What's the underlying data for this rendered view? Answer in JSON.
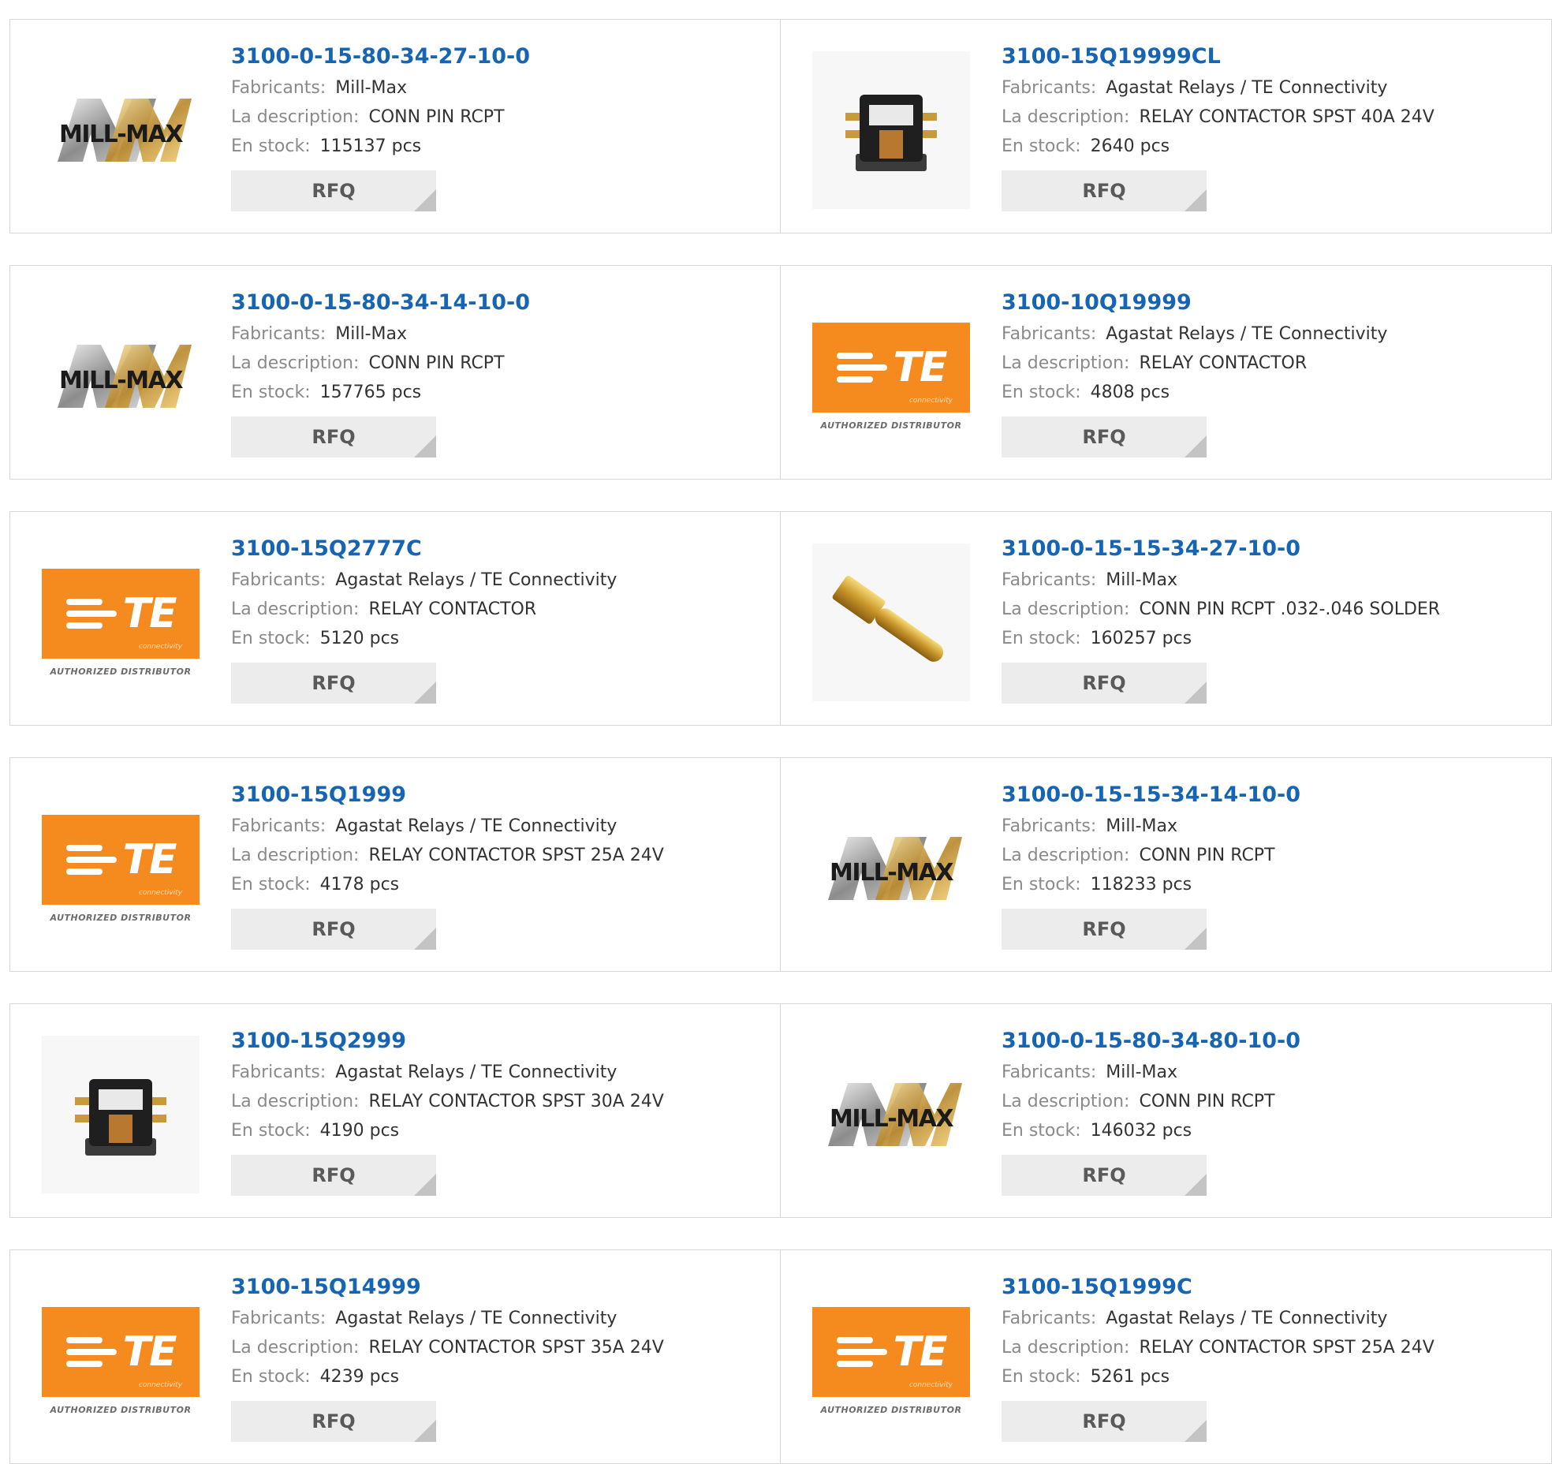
{
  "labels": {
    "manufacturer": "Fabricants:",
    "description": "La description:",
    "stock": "En stock:",
    "rfq": "RFQ"
  },
  "logo_text": {
    "te_brand": "TE",
    "te_sub": "connectivity",
    "te_auth": "AUTHORIZED DISTRIBUTOR",
    "millmax": "MILL-MAX"
  },
  "products": [
    {
      "pn": "3100-0-15-80-34-27-10-0",
      "mfr": "Mill-Max",
      "desc": "CONN PIN RCPT",
      "stock": "115137 pcs",
      "thumb": "millmax-logo"
    },
    {
      "pn": "3100-15Q19999CL",
      "mfr": "Agastat Relays / TE Connectivity",
      "desc": "RELAY CONTACTOR SPST 40A 24V",
      "stock": "2640 pcs",
      "thumb": "relay-photo"
    },
    {
      "pn": "3100-0-15-80-34-14-10-0",
      "mfr": "Mill-Max",
      "desc": "CONN PIN RCPT",
      "stock": "157765 pcs",
      "thumb": "millmax-logo"
    },
    {
      "pn": "3100-10Q19999",
      "mfr": "Agastat Relays / TE Connectivity",
      "desc": "RELAY CONTACTOR",
      "stock": "4808 pcs",
      "thumb": "te-logo"
    },
    {
      "pn": "3100-15Q2777C",
      "mfr": "Agastat Relays / TE Connectivity",
      "desc": "RELAY CONTACTOR",
      "stock": "5120 pcs",
      "thumb": "te-logo"
    },
    {
      "pn": "3100-0-15-15-34-27-10-0",
      "mfr": "Mill-Max",
      "desc": "CONN PIN RCPT .032-.046 SOLDER",
      "stock": "160257 pcs",
      "thumb": "pin-photo"
    },
    {
      "pn": "3100-15Q1999",
      "mfr": "Agastat Relays / TE Connectivity",
      "desc": "RELAY CONTACTOR SPST 25A 24V",
      "stock": "4178 pcs",
      "thumb": "te-logo"
    },
    {
      "pn": "3100-0-15-15-34-14-10-0",
      "mfr": "Mill-Max",
      "desc": "CONN PIN RCPT",
      "stock": "118233 pcs",
      "thumb": "millmax-logo"
    },
    {
      "pn": "3100-15Q2999",
      "mfr": "Agastat Relays / TE Connectivity",
      "desc": "RELAY CONTACTOR SPST 30A 24V",
      "stock": "4190 pcs",
      "thumb": "relay-photo"
    },
    {
      "pn": "3100-0-15-80-34-80-10-0",
      "mfr": "Mill-Max",
      "desc": "CONN PIN RCPT",
      "stock": "146032 pcs",
      "thumb": "millmax-logo"
    },
    {
      "pn": "3100-15Q14999",
      "mfr": "Agastat Relays / TE Connectivity",
      "desc": "RELAY CONTACTOR SPST 35A 24V",
      "stock": "4239 pcs",
      "thumb": "te-logo"
    },
    {
      "pn": "3100-15Q1999C",
      "mfr": "Agastat Relays / TE Connectivity",
      "desc": "RELAY CONTACTOR SPST 25A 24V",
      "stock": "5261 pcs",
      "thumb": "te-logo"
    }
  ]
}
